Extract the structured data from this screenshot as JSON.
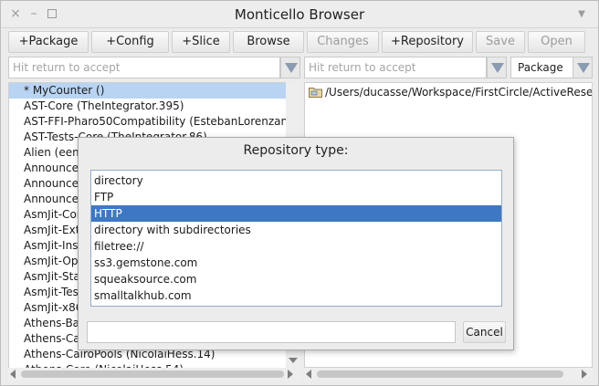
{
  "window": {
    "title": "Monticello Browser",
    "close_glyph": "×",
    "min_glyph": "–",
    "menu_glyph": "▼"
  },
  "toolbar": {
    "buttons": [
      {
        "label": "+Package",
        "enabled": true
      },
      {
        "label": "+Config",
        "enabled": true
      },
      {
        "label": "+Slice",
        "enabled": true
      },
      {
        "label": "Browse",
        "enabled": true
      },
      {
        "label": "Changes",
        "enabled": false
      },
      {
        "label": "+Repository",
        "enabled": true
      },
      {
        "label": "Save",
        "enabled": false
      },
      {
        "label": "Open",
        "enabled": false
      }
    ]
  },
  "left_filter": {
    "placeholder": "Hit return to accept"
  },
  "right_filter": {
    "placeholder": "Hit return to accept"
  },
  "scope_select": {
    "value": "Package"
  },
  "packages": [
    "* MyCounter ()",
    "AST-Core (TheIntegrator.395)",
    "AST-FFI-Pharo50Compatibility (EstebanLorenzano.1)",
    "AST-Tests-Core (TheIntegrator.86)",
    "Alien (eem.",
    "Announcem",
    "Announcem",
    "Announcem",
    "AsmJit-Cor",
    "AsmJit-Exte",
    "AsmJit-Inst",
    "AsmJit-Ope",
    "AsmJit-Sta",
    "AsmJit-Tes",
    "AsmJit-x86",
    "Athens-Bal",
    "Athens-Cai",
    "Athens-CairoPools (NicolaiHess.14)",
    "Athens-Core (NicolaiHess.54)"
  ],
  "selected_package_index": 0,
  "repositories": [
    "/Users/ducasse/Workspace/FirstCircle/ActiveResearch"
  ],
  "dialog": {
    "title": "Repository type:",
    "options": [
      "directory",
      "FTP",
      "HTTP",
      "directory with subdirectories",
      "filetree://",
      "ss3.gemstone.com",
      "squeaksource.com",
      "smalltalkhub.com"
    ],
    "selected_index": 2,
    "input_value": "",
    "cancel_label": "Cancel"
  },
  "icons": {
    "folder": "folder-icon",
    "colors": {
      "selection": "#b9d3f2",
      "dialog_selection": "#3e78c2",
      "dropdown_arrow": "#8a9bb2"
    }
  }
}
